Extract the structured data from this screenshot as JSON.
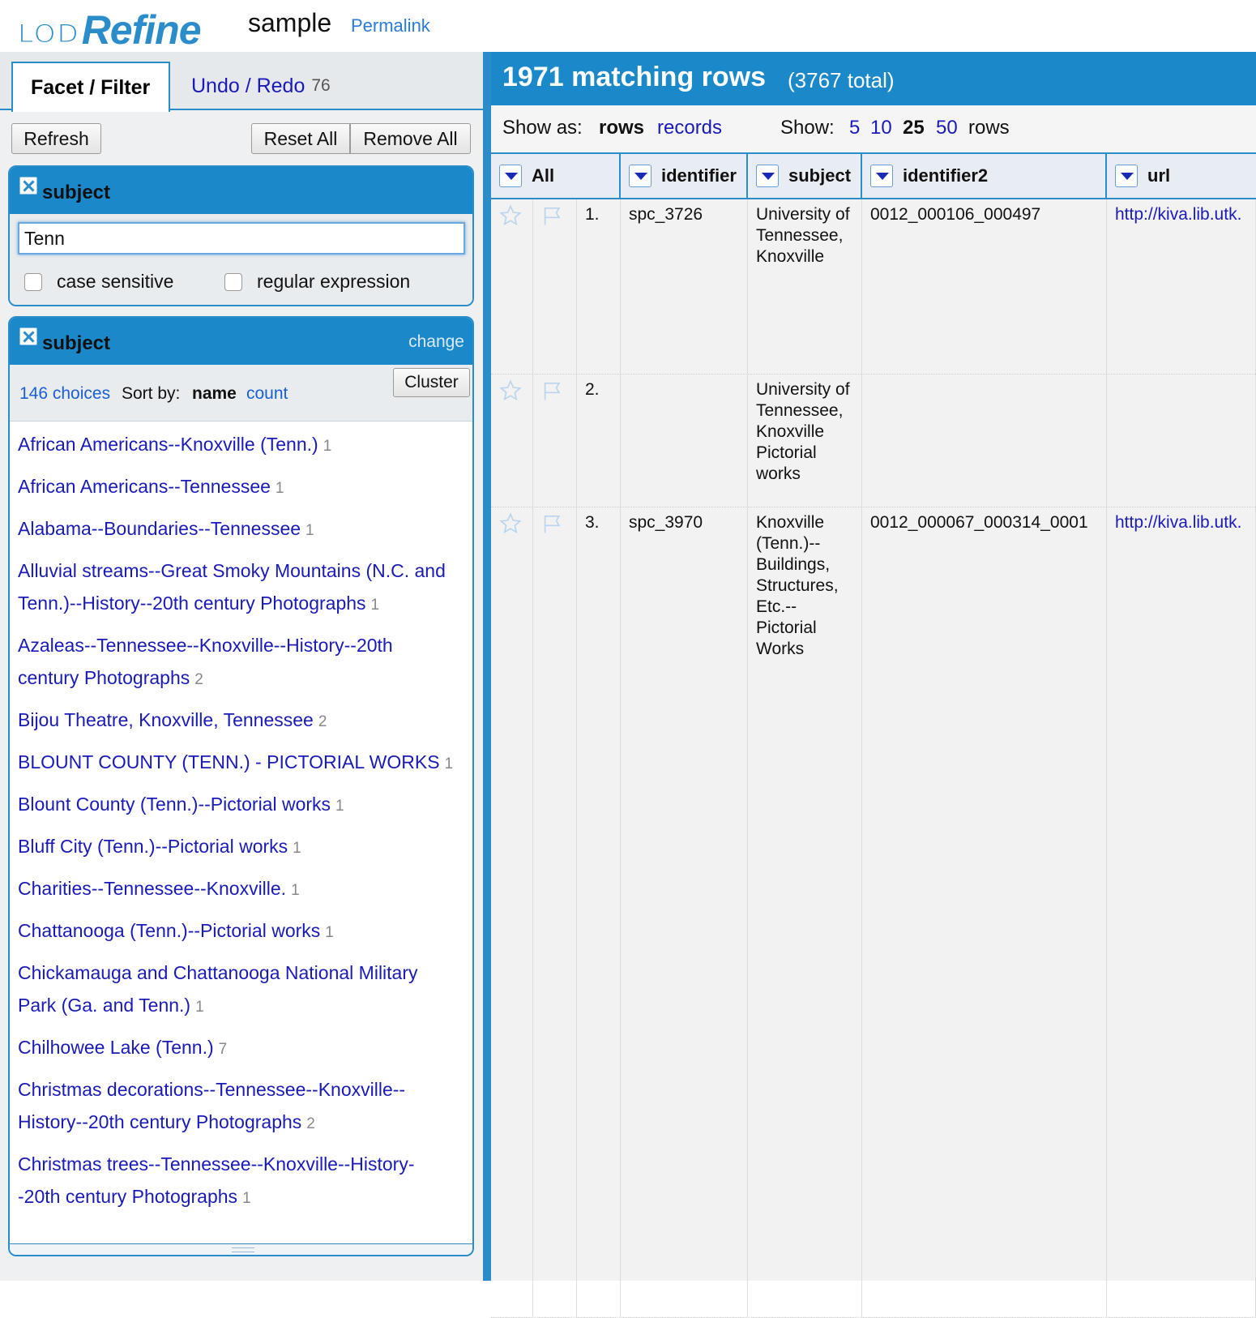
{
  "header": {
    "logo_lod": "LOD",
    "logo_refine": "Refine",
    "project_name": "sample",
    "permalink": "Permalink"
  },
  "tabs": {
    "facet_filter": "Facet / Filter",
    "undo_redo": "Undo / Redo",
    "undo_count": "76"
  },
  "toolbar": {
    "refresh": "Refresh",
    "reset_all": "Reset All",
    "remove_all": "Remove All"
  },
  "text_facet": {
    "title": "subject",
    "value": "Tenn",
    "case_sensitive": "case sensitive",
    "regular_expression": "regular expression"
  },
  "list_facet": {
    "title": "subject",
    "change": "change",
    "choices_count": "146 choices",
    "sort_by": "Sort by:",
    "sort_name": "name",
    "sort_count": "count",
    "cluster": "Cluster",
    "choices": [
      {
        "label": "African Americans--Knoxville (Tenn.)",
        "count": "1"
      },
      {
        "label": "African Americans--Tennessee",
        "count": "1"
      },
      {
        "label": "Alabama--Boundaries--Tennessee",
        "count": "1"
      },
      {
        "label": "Alluvial streams--Great Smoky Mountains (N.C. and Tenn.)--History--20th century Photographs",
        "count": "1"
      },
      {
        "label": "Azaleas--Tennessee--Knoxville--History--20th century  Photographs",
        "count": "2"
      },
      {
        "label": "Bijou Theatre, Knoxville, Tennessee",
        "count": "2"
      },
      {
        "label": "BLOUNT COUNTY (TENN.) - PICTORIAL WORKS",
        "count": "1"
      },
      {
        "label": "Blount County (Tenn.)--Pictorial works",
        "count": "1"
      },
      {
        "label": "Bluff City (Tenn.)--Pictorial works",
        "count": "1"
      },
      {
        "label": "Charities--Tennessee--Knoxville.",
        "count": "1"
      },
      {
        "label": "Chattanooga (Tenn.)--Pictorial works",
        "count": "1"
      },
      {
        "label": "Chickamauga and Chattanooga National Military Park (Ga. and Tenn.)",
        "count": "1"
      },
      {
        "label": "Chilhowee Lake (Tenn.)",
        "count": "7"
      },
      {
        "label": "Christmas decorations--Tennessee--Knoxville--History--20th century  Photographs",
        "count": "2"
      },
      {
        "label": "Christmas trees--Tennessee--Knoxville--History--20th century  Photographs",
        "count": "1"
      }
    ]
  },
  "summary": {
    "matching": "1971 matching rows",
    "total": "(3767 total)"
  },
  "viewbar": {
    "show_as": "Show as:",
    "rows": "rows",
    "records": "records",
    "show": "Show:",
    "opt5": "5",
    "opt10": "10",
    "opt25": "25",
    "opt50": "50",
    "rows_suffix": "rows"
  },
  "columns": [
    "All",
    "identifier",
    "subject",
    "identifier2",
    "url"
  ],
  "rows": [
    {
      "num": "1.",
      "identifier": "spc_3726",
      "subject": "University of Tennessee, Knoxville",
      "identifier2": "0012_000106_000497",
      "url": "http://kiva.lib.utk."
    },
    {
      "num": "2.",
      "identifier": "",
      "subject": "University of Tennessee, Knoxville Pictorial works",
      "identifier2": "",
      "url": ""
    },
    {
      "num": "3.",
      "identifier": "spc_3970",
      "subject": "Knoxville (Tenn.)-- Buildings, Structures, Etc.-- Pictorial Works",
      "identifier2": "0012_000067_000314_0001",
      "url": "http://kiva.lib.utk."
    }
  ]
}
